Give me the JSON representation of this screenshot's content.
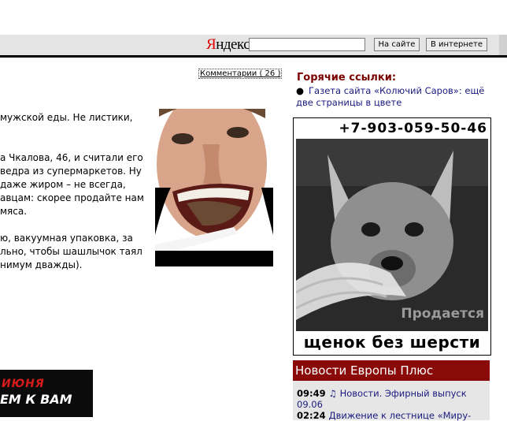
{
  "yandex": {
    "logo_first": "Я",
    "logo_rest": "ндекс",
    "search_value": "",
    "btn_site": "На сайте",
    "btn_internet": "В интернете"
  },
  "article": {
    "comments_link": "Комментарии ( 26 )",
    "lines": [
      "мужской еды. Не листики,",
      "",
      "",
      "а Чкалова, 46, и считали его",
      "ведра из супермаркетов. Ну",
      "даже жиром – не всегда,",
      "авцам: скорее продайте нам",
      "мяса.",
      "",
      "ю, вакуумная упаковка, за",
      "льно, чтобы шашлычок таял",
      "нимум дважды)."
    ]
  },
  "banner": {
    "line1": "ИЮНЯ",
    "line2": "ЕМ К ВАМ"
  },
  "hot_links": {
    "title": "Горячие ссылки:",
    "item1": "Газета сайта «Колючий Саров»: ещё две страницы в цвете"
  },
  "ad": {
    "phone": "+7-903-059-50-46",
    "overlay": "Продается",
    "caption": "щенок без шерсти"
  },
  "news": {
    "title": "Новости Европы Плюс",
    "items": [
      {
        "time": "09:49",
        "text": "♫ Новости. Эфирный выпуск 09.06"
      },
      {
        "time": "02:24",
        "text": "Движение к лестнице «Миру-"
      }
    ]
  }
}
